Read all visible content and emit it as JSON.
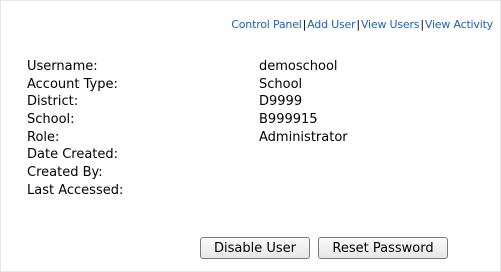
{
  "nav": {
    "links": [
      "Control Panel",
      "Add User",
      "View Users",
      "View Activity"
    ],
    "separator": "|"
  },
  "details": [
    {
      "label": "Username:",
      "value": "demoschool"
    },
    {
      "label": "Account Type:",
      "value": "School"
    },
    {
      "label": "District:",
      "value": "D9999"
    },
    {
      "label": "School:",
      "value": "B999915"
    },
    {
      "label": "Role:",
      "value": "Administrator"
    },
    {
      "label": "Date Created:",
      "value": ""
    },
    {
      "label": "Created By:",
      "value": ""
    },
    {
      "label": "Last Accessed:",
      "value": ""
    }
  ],
  "actions": {
    "disable_label": "Disable User",
    "reset_label": "Reset Password"
  },
  "colors": {
    "link": "#1f5fb4",
    "text": "#000000",
    "border": "#e6e6e6"
  }
}
